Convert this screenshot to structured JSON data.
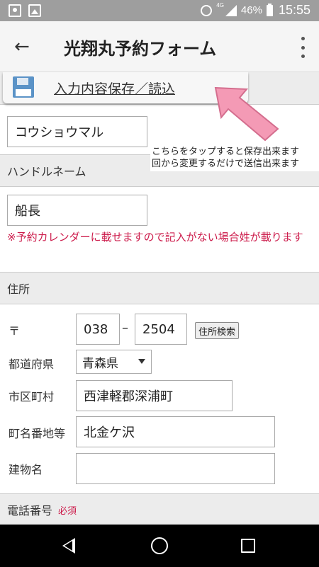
{
  "status_bar": {
    "network": "4G",
    "battery": "46%",
    "time": "15:55"
  },
  "app_bar": {
    "back_icon": "←",
    "title": "光翔丸予約フォーム"
  },
  "form": {
    "save_button_label": "入力内容保存／読込",
    "katakana_value": "コウショウマル",
    "hint_line1": "こちらをタップすると保存出来ます",
    "hint_line2": "回から変更するだけで送信出来ます",
    "handle_header": "ハンドルネーム",
    "handle_value": "船長",
    "handle_warning": "※予約カレンダーに載せますので記入がない場合姓が載ります",
    "address_header": "住所",
    "postal_label": "〒",
    "postal_first": "038",
    "postal_dash": "–",
    "postal_second": "2504",
    "address_search_button": "住所検索",
    "prefecture_label": "都道府県",
    "prefecture_value": "青森県",
    "city_label": "市区町村",
    "city_value": "西津軽郡深浦町",
    "town_label": "町名番地等",
    "town_value": "北金ケ沢",
    "building_label": "建物名",
    "building_value": "",
    "phone_header": "電話番号",
    "phone_required": "必須"
  },
  "colors": {
    "warning": "#cc1a4a",
    "arrow": "#f49ab5",
    "save_icon": "#5b93c7"
  },
  "icons": [
    "contact-icon",
    "image-icon",
    "alarm-icon",
    "signal-icon",
    "battery-icon",
    "back-arrow-icon",
    "more-vert-icon",
    "floppy-disk-icon",
    "pink-arrow-icon",
    "dropdown-caret-icon",
    "nav-back-icon",
    "nav-home-icon",
    "nav-recent-icon"
  ]
}
